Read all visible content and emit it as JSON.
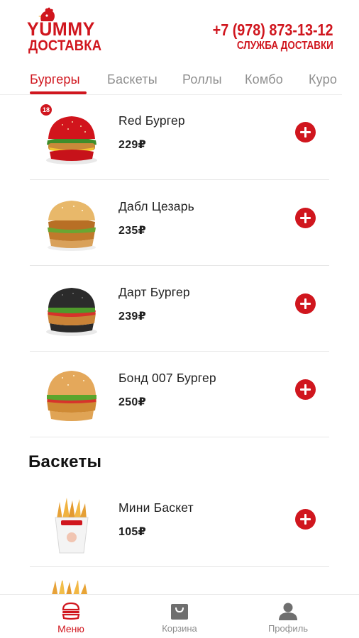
{
  "brand": {
    "line1": "YUMMY",
    "line2": "ДОСТАВКА"
  },
  "contact": {
    "phone": "+7 (978) 873-13-12",
    "service": "СЛУЖБА ДОСТАВКИ"
  },
  "tabs": [
    {
      "label": "Бургеры"
    },
    {
      "label": "Баскеты"
    },
    {
      "label": "Роллы"
    },
    {
      "label": "Комбо"
    },
    {
      "label": "Куро"
    }
  ],
  "active_tab": "Бургеры",
  "burgers": [
    {
      "name": "Red Бургер",
      "price": "229₽",
      "badge": "18"
    },
    {
      "name": "Дабл Цезарь",
      "price": "235₽"
    },
    {
      "name": "Дарт Бургер",
      "price": "239₽"
    },
    {
      "name": "Бонд 007 Бургер",
      "price": "250₽"
    }
  ],
  "baskets_section": {
    "title": "Баскеты"
  },
  "baskets": [
    {
      "name": "Мини Баскет",
      "price": "105₽"
    }
  ],
  "bottom_nav": [
    {
      "label": "Меню",
      "icon": "burger-icon"
    },
    {
      "label": "Корзина",
      "icon": "bag-icon"
    },
    {
      "label": "Профиль",
      "icon": "user-icon"
    }
  ],
  "colors": {
    "accent": "#d0161e",
    "muted": "#8f8f8f",
    "divider": "#e6e6e6"
  }
}
